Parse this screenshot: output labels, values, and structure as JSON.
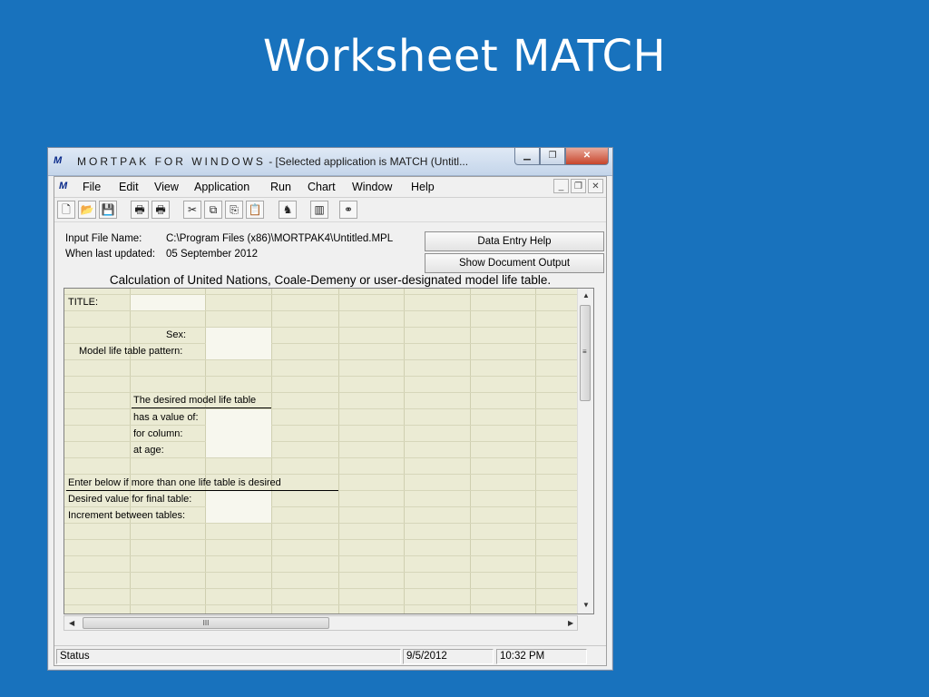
{
  "slide": {
    "title": "Worksheet MATCH"
  },
  "window": {
    "title_brand": "MORTPAK FOR WINDOWS",
    "title_rest": " - [Selected application is MATCH  (Untitl...",
    "app_icon_text": "M",
    "minimize_glyph": "▁",
    "maximize_glyph": "❐",
    "close_glyph": "✕"
  },
  "menubar": {
    "items": [
      "File",
      "Edit",
      "View",
      "Application",
      "Run",
      "Chart",
      "Window",
      "Help"
    ],
    "mdi_minimize": "_",
    "mdi_restore": "❐",
    "mdi_close": "✕"
  },
  "toolbar": {
    "icons": [
      "new-file-icon",
      "open-folder-icon",
      "save-icon",
      "print-icon",
      "print-preview-icon",
      "cut-icon",
      "copy-icon",
      "paste-icon",
      "clipboard-icon",
      "run-figure-icon",
      "bar-chart-icon",
      "binoculars-icon"
    ],
    "glyphs": [
      "🗋",
      "📂",
      "💾",
      "🖶",
      "🖶",
      "✂",
      "⧉",
      "⎘",
      "📋",
      "♞",
      "▥",
      "⚭"
    ]
  },
  "info": {
    "input_label": "Input File Name:",
    "input_value": "C:\\Program Files (x86)\\MORTPAK4\\Untitled.MPL",
    "updated_label": "When last updated:",
    "updated_value": "05 September 2012"
  },
  "buttons": {
    "data_entry_help": "Data Entry Help",
    "show_document_output": "Show Document Output"
  },
  "caption": "Calculation of United Nations, Coale-Demeny or user-designated model life table.",
  "worksheet": {
    "title_label": "TITLE:",
    "sex_label": "Sex:",
    "pattern_label": "Model life table pattern:",
    "desired_header": "The desired model life table",
    "has_value": "has a value of:",
    "for_column": "for column:",
    "at_age": "at age:",
    "enter_below": "Enter below if more than one life table is desired",
    "final_value": "Desired value for final table:",
    "increment": "Increment between tables:"
  },
  "scroll": {
    "up": "▲",
    "down": "▼",
    "left": "◀",
    "right": "▶",
    "grip": "≡",
    "hgrip": "III"
  },
  "status": {
    "text": "Status",
    "date": "9/5/2012",
    "time": "10:32 PM"
  }
}
